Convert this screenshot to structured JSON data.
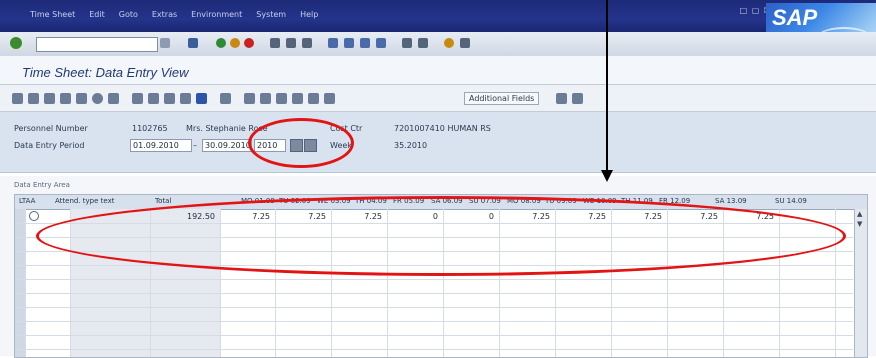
{
  "menubar": {
    "items": [
      "Time Sheet",
      "Edit",
      "Goto",
      "Extras",
      "Environment",
      "System",
      "Help"
    ],
    "window_controls": "□ ▢ ☒"
  },
  "logo": {
    "text": "SAP"
  },
  "toolbar": {
    "command_field_value": ""
  },
  "title": {
    "text": "Time Sheet: Data Entry View"
  },
  "app_toolbar": {
    "additional_fields_label": "Additional Fields"
  },
  "header": {
    "personnel_number_label": "Personnel Number",
    "personnel_number_value": "1102765",
    "employee_name": "Mrs. Stephanie Rose",
    "cost_ctr_label": "Cost Ctr",
    "cost_ctr_value": "7201007410  HUMAN RS",
    "period_label": "Data Entry Period",
    "period_from": "01.09.2010",
    "period_to": "30.09.2010",
    "week_field": "2010",
    "week_label": "Week",
    "week_value": "35.2010"
  },
  "table": {
    "section_title": "Data Entry Area",
    "headers": [
      "LTAA",
      "Attend. type text",
      "Total",
      "MO 01.09",
      "TU 02.09",
      "WE 03.09",
      "TH 04.09",
      "FR 05.09",
      "SA 06.09",
      "SU 07.09",
      "MO 08.09",
      "TU 09.09",
      "WE 10.09",
      "TH 11.09",
      "FR 12.09",
      "SA 13.09",
      "SU 14.09"
    ],
    "first_row": {
      "total": "192.50",
      "days": [
        "7.25",
        "7.25",
        "7.25",
        "0",
        "0",
        "7.25",
        "7.25",
        "7.25",
        "7.25",
        "7.25"
      ]
    }
  }
}
